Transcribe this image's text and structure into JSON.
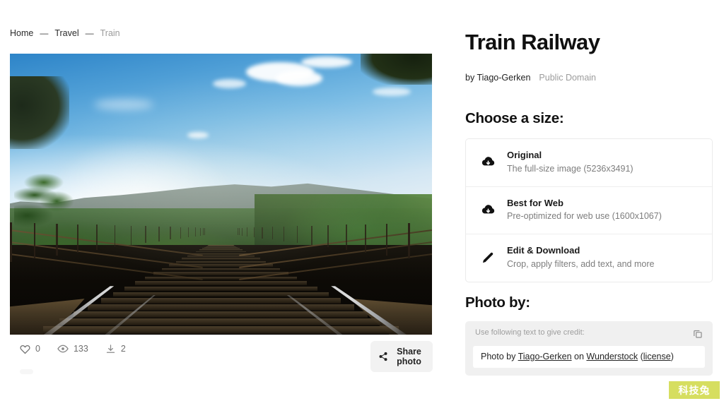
{
  "breadcrumb": {
    "items": [
      {
        "label": "Home",
        "current": false
      },
      {
        "label": "Travel",
        "current": false
      },
      {
        "label": "Train",
        "current": true
      }
    ],
    "separator": "—"
  },
  "photo": {
    "alt": "Train railway tracks over a bridge receding to a vanishing point with mountains and blue sky",
    "subject": "train-railway-tracks"
  },
  "stats": {
    "likes": "0",
    "views": "133",
    "downloads": "2",
    "share_label": "Share photo"
  },
  "detail": {
    "title": "Train Railway",
    "author_prefix": "by ",
    "author": "Tiago-Gerken",
    "byline": "by Tiago-Gerken",
    "license": "Public Domain"
  },
  "sizes": {
    "heading": "Choose a size:",
    "options": [
      {
        "icon": "cloud-download-icon",
        "title": "Original",
        "subtitle": "The full-size image (5236x3491)"
      },
      {
        "icon": "cloud-download-icon",
        "title": "Best for Web",
        "subtitle": "Pre-optimized for web use (1600x1067)"
      },
      {
        "icon": "pencil-icon",
        "title": "Edit & Download",
        "subtitle": "Crop, apply filters, add text, and more"
      }
    ]
  },
  "photo_by": {
    "heading": "Photo by:",
    "instruction": "Use following text to give credit:",
    "credit_prefix": "Photo by ",
    "credit_author": "Tiago-Gerken",
    "credit_middle": " on ",
    "credit_site": "Wunderstock",
    "credit_suffix_open": " (",
    "credit_license": "license",
    "credit_suffix_close": ")",
    "copy_icon": "copy-icon"
  },
  "watermark": {
    "text": "科技兔",
    "color": "#d6de60"
  }
}
